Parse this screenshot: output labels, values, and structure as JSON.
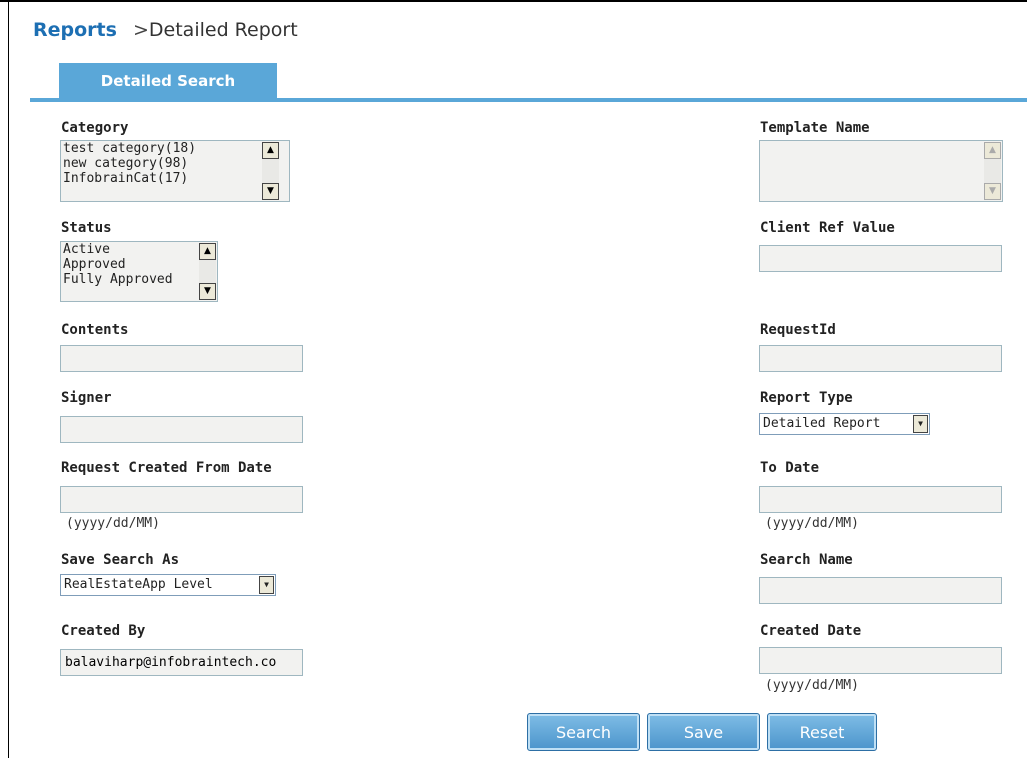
{
  "breadcrumb": {
    "root": "Reports",
    "separator": ">",
    "current": "Detailed Report"
  },
  "tab": {
    "label": "Detailed Search"
  },
  "form": {
    "category": {
      "label": "Category",
      "options": [
        "test category(18)",
        "new category(98)",
        "InfobrainCat(17)"
      ]
    },
    "status": {
      "label": "Status",
      "options": [
        "Active",
        "Approved",
        "Fully Approved"
      ]
    },
    "contents": {
      "label": "Contents",
      "value": ""
    },
    "signer": {
      "label": "Signer",
      "value": ""
    },
    "from_date": {
      "label": "Request Created From Date",
      "value": "",
      "hint": "(yyyy/dd/MM)"
    },
    "save_search_as": {
      "label": "Save Search As",
      "selected": "RealEstateApp Level"
    },
    "created_by": {
      "label": "Created By",
      "value": "balaviharp@infobraintech.co"
    },
    "template_name": {
      "label": "Template Name",
      "options": []
    },
    "client_ref": {
      "label": "Client Ref Value",
      "value": ""
    },
    "request_id": {
      "label": "RequestId",
      "value": ""
    },
    "report_type": {
      "label": "Report Type",
      "selected": "Detailed Report"
    },
    "to_date": {
      "label": "To Date",
      "value": "",
      "hint": "(yyyy/dd/MM)"
    },
    "search_name": {
      "label": "Search Name",
      "value": ""
    },
    "created_date": {
      "label": "Created Date",
      "value": "",
      "hint": "(yyyy/dd/MM)"
    }
  },
  "buttons": {
    "search": "Search",
    "save": "Save",
    "reset": "Reset"
  },
  "icons": {
    "scroll_up": "triangle-up-icon",
    "scroll_down": "triangle-down-icon",
    "dropdown": "chevron-down-icon"
  },
  "colors": {
    "accent": "#5aa7d8",
    "link": "#1d6fb3",
    "field_bg": "#f2f2f0"
  }
}
